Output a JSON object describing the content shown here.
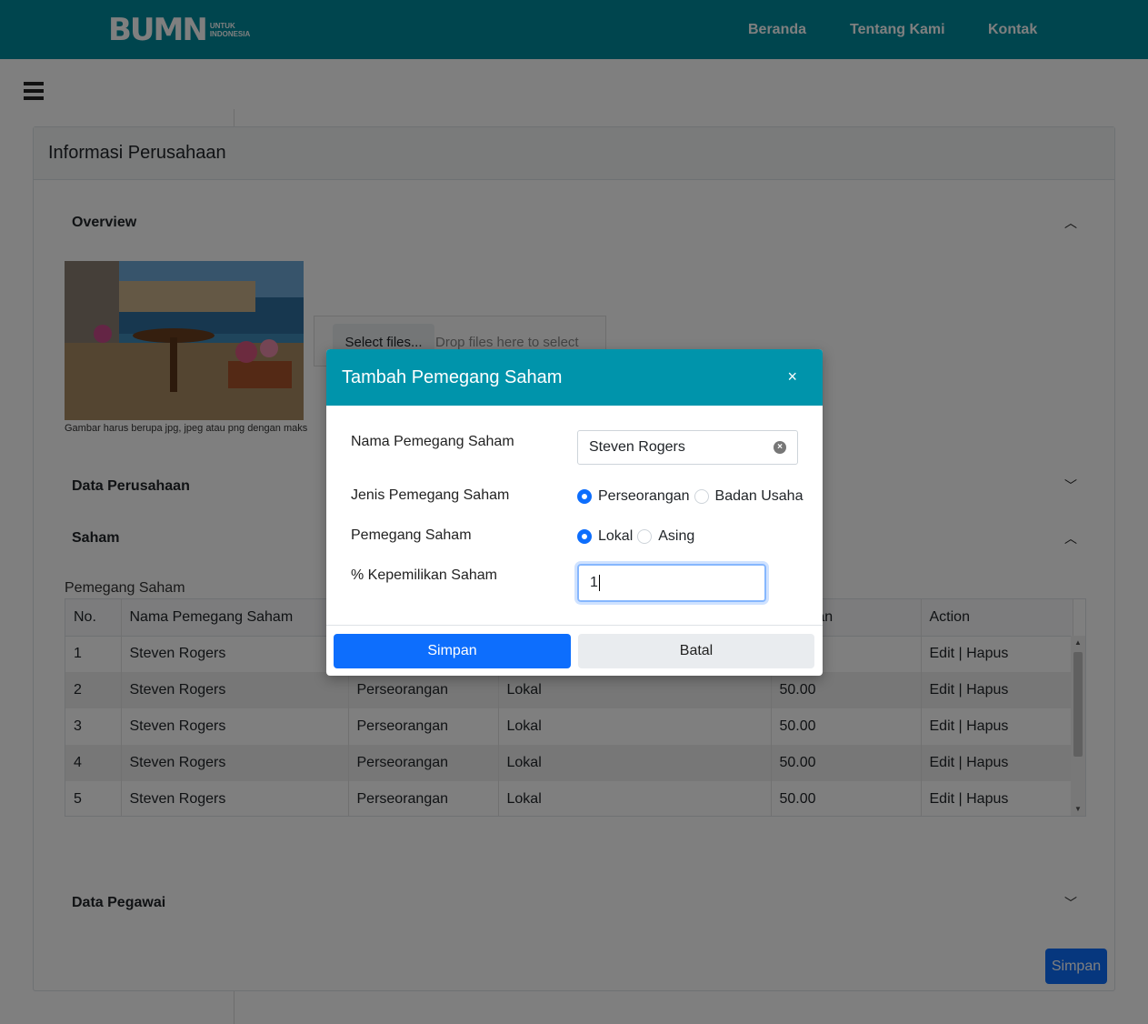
{
  "navbar": {
    "logo": {
      "mark": "BUMN",
      "tagline": "UNTUK INDONESIA"
    },
    "links": [
      "Beranda",
      "Tentang Kami",
      "Kontak"
    ],
    "color": "#008b9c"
  },
  "card": {
    "title": "Informasi Perusahaan",
    "sections": {
      "overview": "Overview",
      "data_perusahaan": "Data Perusahaan",
      "saham": "Saham",
      "data_pegawai": "Data Pegawai"
    },
    "upload": {
      "note": "Gambar harus berupa jpg, jpeg atau png dengan maks",
      "select_label": "Select files...",
      "drop_hint": "Drop files here to select"
    },
    "table": {
      "label": "Pemegang Saham",
      "columns": [
        "No.",
        "Nama Pemegang Saham",
        "",
        "",
        "emilikan",
        "Action"
      ],
      "rows": [
        [
          "1",
          "Steven Rogers",
          "",
          "",
          "",
          "Edit | Hapus"
        ],
        [
          "2",
          "Steven Rogers",
          "Perseorangan",
          "Lokal",
          "50.00",
          "Edit | Hapus"
        ],
        [
          "3",
          "Steven Rogers",
          "Perseorangan",
          "Lokal",
          "50.00",
          "Edit | Hapus"
        ],
        [
          "4",
          "Steven Rogers",
          "Perseorangan",
          "Lokal",
          "50.00",
          "Edit | Hapus"
        ],
        [
          "5",
          "Steven Rogers",
          "Perseorangan",
          "Lokal",
          "50.00",
          "Edit | Hapus"
        ]
      ]
    },
    "save_label": "Simpan"
  },
  "modal": {
    "title": "Tambah Pemegang Saham",
    "close": "×",
    "header_color": "#0094ab",
    "fields": {
      "nama_label": "Nama Pemegang Saham",
      "nama_value": "Steven Rogers",
      "jenis_label": "Jenis Pemegang Saham",
      "jenis_options": [
        "Perseorangan",
        "Badan Usaha"
      ],
      "jenis_selected": "Perseorangan",
      "pemegang_label": "Pemegang Saham",
      "pemegang_options": [
        "Lokal",
        "Asing"
      ],
      "pemegang_selected": "Lokal",
      "pct_label": "% Kepemilikan Saham",
      "pct_value": "1"
    },
    "buttons": {
      "save": "Simpan",
      "cancel": "Batal"
    }
  }
}
